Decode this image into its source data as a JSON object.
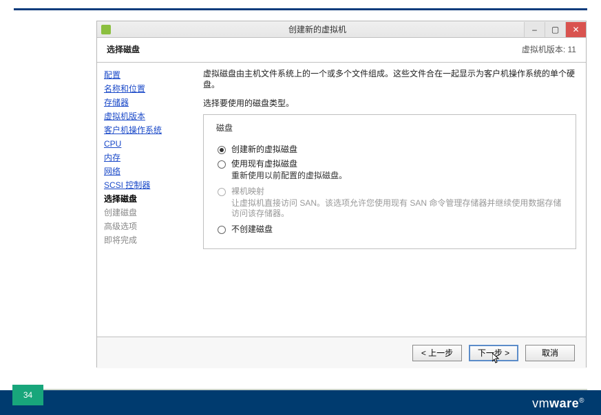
{
  "window": {
    "title": "创建新的虚拟机",
    "minimize": "–",
    "maximize": "▢",
    "close": "✕"
  },
  "header": {
    "title": "选择磁盘",
    "version": "虚拟机版本: 11"
  },
  "sidebar": {
    "items": [
      {
        "label": "配置",
        "kind": "link"
      },
      {
        "label": "名称和位置",
        "kind": "link"
      },
      {
        "label": "存储器",
        "kind": "link"
      },
      {
        "label": "虚拟机版本",
        "kind": "link"
      },
      {
        "label": "客户机操作系统",
        "kind": "link"
      },
      {
        "label": "CPU",
        "kind": "link"
      },
      {
        "label": "内存",
        "kind": "link"
      },
      {
        "label": "网络",
        "kind": "link"
      },
      {
        "label": "SCSI 控制器",
        "kind": "link"
      },
      {
        "label": "选择磁盘",
        "kind": "current"
      },
      {
        "label": "创建磁盘",
        "kind": "disabled"
      },
      {
        "label": "高级选项",
        "kind": "disabled"
      },
      {
        "label": "即将完成",
        "kind": "disabled"
      }
    ]
  },
  "content": {
    "description": "虚拟磁盘由主机文件系统上的一个或多个文件组成。这些文件合在一起显示为客户机操作系统的单个硬盘。",
    "instruction": "选择要使用的磁盘类型。",
    "group_title": "磁盘",
    "options": [
      {
        "label": "创建新的虚拟磁盘",
        "sub": "",
        "selected": true,
        "enabled": true
      },
      {
        "label": "使用现有虚拟磁盘",
        "sub": "重新使用以前配置的虚拟磁盘。",
        "selected": false,
        "enabled": true
      },
      {
        "label": "裸机映射",
        "sub": "让虚拟机直接访问 SAN。该选项允许您使用现有 SAN 命令管理存储器并继续使用数据存储访问该存储器。",
        "selected": false,
        "enabled": false
      },
      {
        "label": "不创建磁盘",
        "sub": "",
        "selected": false,
        "enabled": true
      }
    ]
  },
  "footer": {
    "back": "< 上一步",
    "next": "下一步 >",
    "cancel": "取消"
  },
  "slide": {
    "page_number": "34",
    "brand_light": "vm",
    "brand_bold": "ware"
  }
}
